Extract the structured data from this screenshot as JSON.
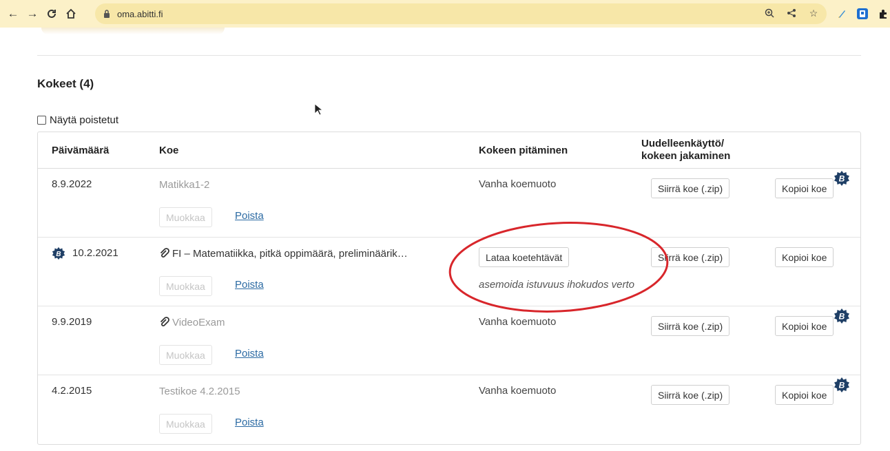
{
  "browser": {
    "url": "oma.abitti.fi",
    "icons": [
      "back-arrow",
      "forward-arrow",
      "reload-icon",
      "home-icon",
      "lock-icon",
      "zoom-icon",
      "share-icon",
      "star-icon",
      "ext-pen-icon",
      "ext-abitti-icon",
      "puzzle-icon",
      "sidepanel-icon",
      "profile-avatar"
    ]
  },
  "section": {
    "title": "Kokeet (4)",
    "show_deleted_label": "Näytä poistetut"
  },
  "table": {
    "headers": {
      "date": "Päivämäärä",
      "exam": "Koe",
      "holding": "Kokeen pitäminen",
      "reuse_line1": "Uudelleenkäyttö/",
      "reuse_line2": "kokeen jakaminen"
    },
    "rows": [
      {
        "date": "8.9.2022",
        "exam": "Matikka1-2",
        "edit": "Muokkaa",
        "delete": "Poista",
        "holding": "Vanha koemuoto",
        "move": "Siirrä koe (.zip)",
        "copy": "Kopioi koe"
      },
      {
        "date": "10.2.2021",
        "exam": "FI – Matematiikka, pitkä oppimäärä, preliminäärik…",
        "edit": "Muokkaa",
        "delete": "Poista",
        "download": "Lataa koetehtävät",
        "passphrase": "asemoida istuvuus ihokudos verto",
        "move": "Siirrä koe (.zip)",
        "copy": "Kopioi koe"
      },
      {
        "date": "9.9.2019",
        "exam": "VideoExam",
        "edit": "Muokkaa",
        "delete": "Poista",
        "holding": "Vanha koemuoto",
        "move": "Siirrä koe (.zip)",
        "copy": "Kopioi koe"
      },
      {
        "date": "4.2.2015",
        "exam": "Testikoe 4.2.2015",
        "edit": "Muokkaa",
        "delete": "Poista",
        "holding": "Vanha koemuoto",
        "move": "Siirrä koe (.zip)",
        "copy": "Kopioi koe"
      }
    ]
  },
  "colors": {
    "chrome_bg": "#fcf1c8",
    "link": "#2b6aa3",
    "badge": "#1f3f66",
    "annotation": "#d8262b"
  }
}
